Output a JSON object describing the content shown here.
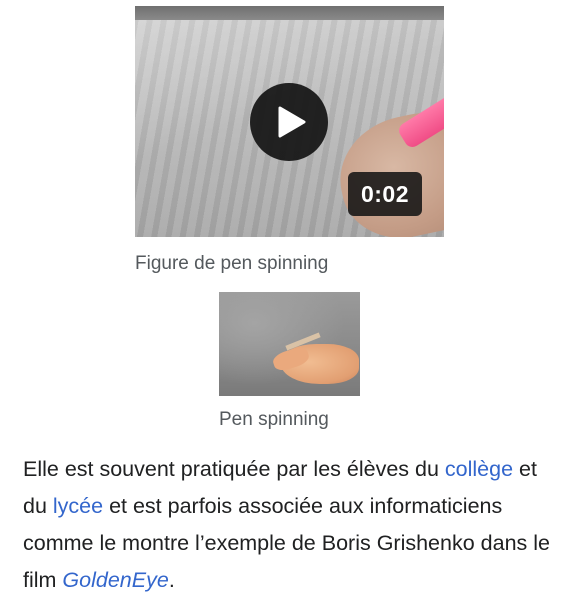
{
  "video": {
    "duration": "0:02",
    "play_icon": "play-icon"
  },
  "figure1": {
    "caption": "Figure de pen spinning"
  },
  "figure2": {
    "caption": "Pen spinning"
  },
  "article": {
    "text1": "Elle est souvent pratiquée par les élèves du ",
    "link_college": "collège",
    "text2": " et du ",
    "link_lycee": "lycée",
    "text3": " et est parfois associée aux informaticiens comme le montre l’exemple de Boris Grishenko dans le film ",
    "link_goldeneye": "GoldenEye",
    "text4": "."
  },
  "colors": {
    "link": "#3366cc",
    "text": "#202122",
    "caption": "#54595d",
    "overlay": "#141414"
  }
}
